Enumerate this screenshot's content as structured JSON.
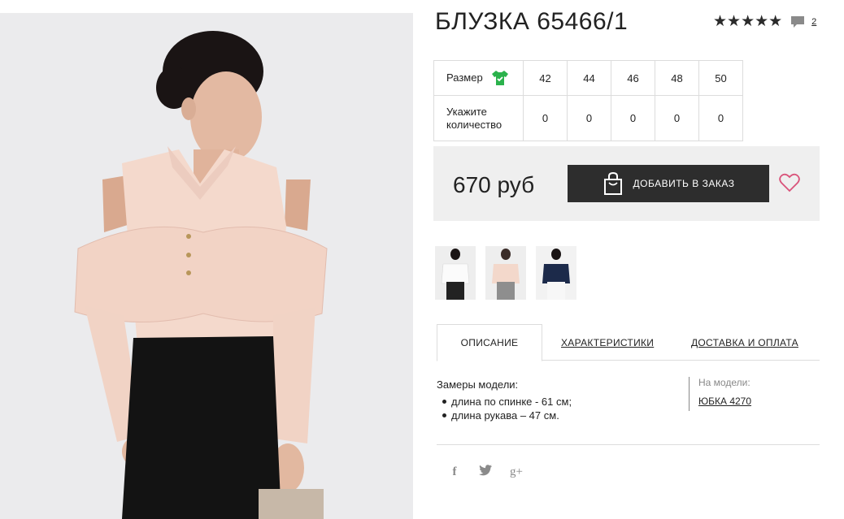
{
  "product": {
    "title": "БЛУЗКА 65466/1",
    "rating_stars": "★★★★★",
    "comments_count": "2",
    "price": "670 руб"
  },
  "sizes": {
    "size_label": "Размер",
    "quantity_label": "Укажите количество",
    "values": [
      "42",
      "44",
      "46",
      "48",
      "50"
    ],
    "quantities": [
      "0",
      "0",
      "0",
      "0",
      "0"
    ]
  },
  "actions": {
    "add_to_order": "ДОБАВИТЬ В ЗАКАЗ"
  },
  "tabs": [
    "ОПИСАНИЕ",
    "ХАРАКТЕРИСТИКИ",
    "ДОСТАВКА И ОПЛАТА"
  ],
  "description": {
    "lead": "Замеры модели:",
    "items": [
      "длина по спинке - 61 см;",
      "длина рукава – 47 см."
    ]
  },
  "on_model": {
    "label": "На модели:",
    "link": "ЮБКА 4270"
  },
  "social": {
    "facebook": "f",
    "twitter": "🐦",
    "google_plus": "g+"
  },
  "colors": {
    "dark": "#2d2d2d",
    "accent_green": "#2bb24c",
    "heart": "#d9537a",
    "panel": "#efefef"
  }
}
